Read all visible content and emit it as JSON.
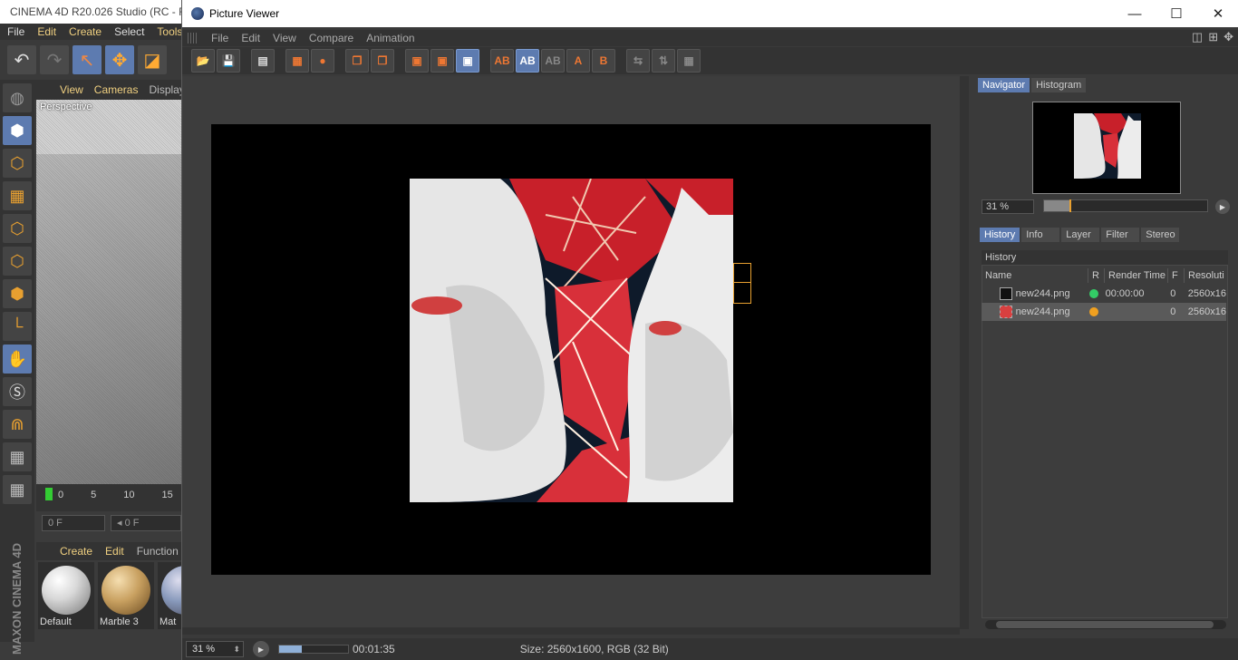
{
  "c4d": {
    "title": "CINEMA 4D R20.026 Studio (RC - R2",
    "menu": [
      "File",
      "Edit",
      "Create",
      "Select",
      "Tools"
    ],
    "viewport_menu": [
      "View",
      "Cameras",
      "Display"
    ],
    "viewport_label": "Perspective",
    "timeline_ticks": [
      "0",
      "5",
      "10",
      "15"
    ],
    "frame_fields": [
      "0 F",
      "◂ 0 F"
    ],
    "material_menu": [
      "Create",
      "Edit",
      "Function"
    ],
    "materials": [
      {
        "name": "Default",
        "color": "#d8d8d8"
      },
      {
        "name": "Marble 3",
        "color": "#c8a060"
      },
      {
        "name": "Mat",
        "color": "#8899bb"
      }
    ],
    "brand": "MAXON CINEMA 4D"
  },
  "pv": {
    "title": "Picture Viewer",
    "window_buttons": {
      "minimize": "—",
      "maximize": "☐",
      "close": "✕"
    },
    "menu": [
      "File",
      "Edit",
      "View",
      "Compare",
      "Animation"
    ],
    "toolbar_labels": [
      "AB",
      "AB",
      "AB",
      "A",
      "B"
    ],
    "status": {
      "zoom": "31 %",
      "progress": 0.33,
      "time": "00:01:35",
      "size": "Size: 2560x1600, RGB (32 Bit)"
    }
  },
  "panel": {
    "top_tabs": [
      "Navigator",
      "Histogram"
    ],
    "zoom": "31 %",
    "zoom_fraction": 0.31,
    "bottom_tabs": [
      "History",
      "Info",
      "Layer",
      "Filter",
      "Stereo"
    ],
    "history_title": "History",
    "columns": [
      "Name",
      "R",
      "Render Time",
      "F",
      "Resoluti"
    ],
    "rows": [
      {
        "name": "new244.png",
        "status_color": "#33cc66",
        "render_time": "00:00:00",
        "f": "0",
        "res": "2560x16"
      },
      {
        "name": "new244.png",
        "status_color": "#f0a020",
        "render_time": "",
        "f": "0",
        "res": "2560x16"
      }
    ]
  }
}
